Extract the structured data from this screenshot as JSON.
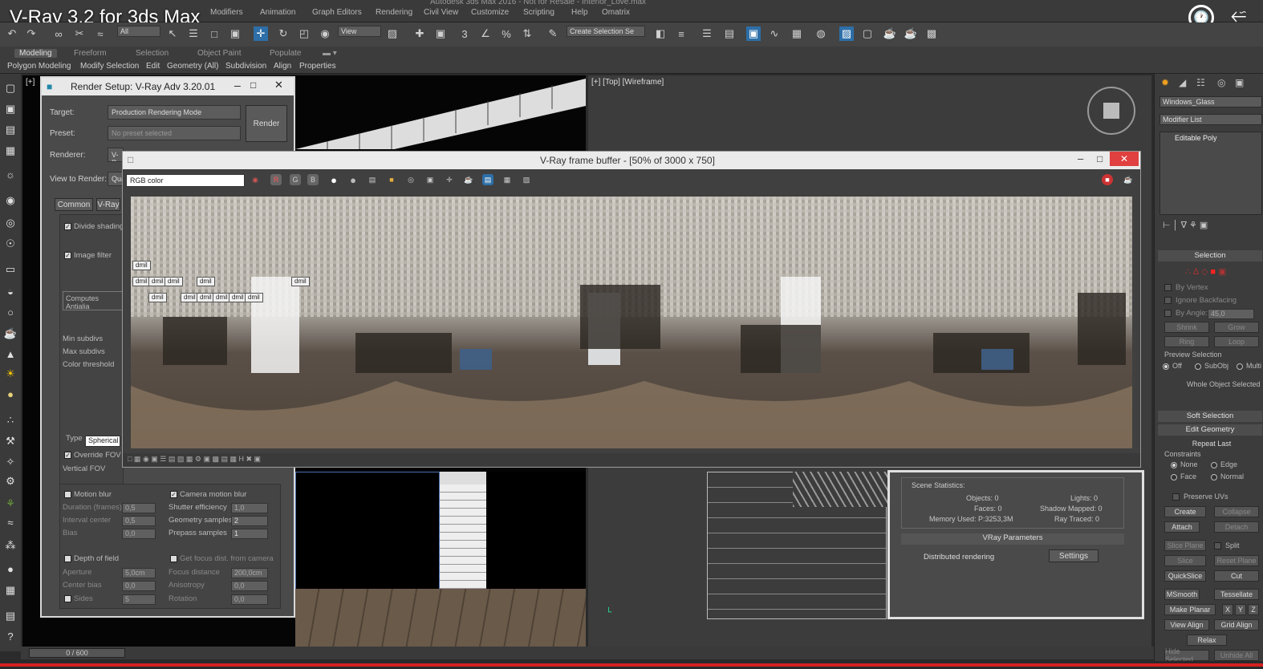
{
  "video": {
    "title": "V-Ray 3.2 for 3ds Max",
    "clock_icon": "clock-icon",
    "share_icon": "share-icon"
  },
  "app": {
    "title": "Autodesk 3ds Max 2016 - Not for Resale - Interior_Love.max"
  },
  "menus": [
    "Modifiers",
    "Animation",
    "Graph Editors",
    "Rendering",
    "Civil View",
    "Customize",
    "Scripting",
    "Help",
    "Omatrix"
  ],
  "toolbar": {
    "selection_filter": "All",
    "ref_coord": "View",
    "selection_set": "Create Selection Se"
  },
  "ribbon": {
    "tabs": [
      "Modeling",
      "Freeform",
      "Selection",
      "Object Paint",
      "Populate"
    ],
    "active_tab": "Modeling",
    "subtabs": [
      "Polygon Modeling",
      "Modify Selection",
      "Edit",
      "Geometry (All)",
      "Subdivision",
      "Align",
      "Properties"
    ]
  },
  "viewport_top": {
    "label": "[+] [Top] [Wireframe]"
  },
  "viewport_left": {
    "label": "[+]"
  },
  "render_setup": {
    "title": "Render Setup: V-Ray Adv 3.20.01",
    "target_label": "Target:",
    "target_value": "Production Rendering Mode",
    "preset_label": "Preset:",
    "preset_value": "No preset selected",
    "renderer_label": "Renderer:",
    "renderer_value": "V-Ray",
    "view_label": "View to Render:",
    "view_value": "Quad",
    "render_button": "Render",
    "tabs": [
      "Common",
      "V-Ray"
    ],
    "divide_shading": "Divide shading",
    "image_filter": "Image filter",
    "computes_aa": "Computes Antialia",
    "min_subdivs": "Min subdivs",
    "max_subdivs": "Max subdivs",
    "color_threshold": "Color threshold",
    "type_label": "Type",
    "type_value": "Spherical p",
    "override_fov": "Override FOV",
    "vertical_fov": "Vertical FOV",
    "motion_blur": "Motion blur",
    "camera_motion_blur": "Camera motion blur",
    "duration_label": "Duration (frames)",
    "duration_value": "0,5",
    "shutter_label": "Shutter efficiency",
    "shutter_value": "1,0",
    "interval_label": "Interval center",
    "interval_value": "0,5",
    "geom_samples_label": "Geometry samples",
    "geom_samples_value": "2",
    "bias_label": "Bias",
    "bias_value": "0,0",
    "prepass_label": "Prepass samples",
    "prepass_value": "1",
    "dof": "Depth of field",
    "focus_from_camera": "Get focus dist. from camera",
    "aperture_label": "Aperture",
    "aperture_value": "5,0cm",
    "focus_dist_label": "Focus distance",
    "focus_dist_value": "200,0cm",
    "center_bias_label": "Center bias",
    "center_bias_value": "0,0",
    "anisotropy_label": "Anisotropy",
    "anisotropy_value": "0,0",
    "sides_label": "Sides",
    "sides_value": "5",
    "rotation_label": "Rotation",
    "rotation_value": "0,0"
  },
  "frame_buffer": {
    "title": "V-Ray frame buffer - [50% of 3000 x 750]",
    "channel": "RGB color",
    "bucket_label": "dmil"
  },
  "stats": {
    "header": "Scene Statistics:",
    "objects": "Objects: 0",
    "lights": "Lights: 0",
    "faces": "Faces: 0",
    "shadow_mapped": "Shadow Mapped: 0",
    "memory": "Memory Used: P:3253,3M",
    "ray_traced": "Ray Traced: 0",
    "vray_params": "VRay Parameters",
    "distributed": "Distributed rendering",
    "settings_button": "Settings"
  },
  "command_panel": {
    "object_name": "Windows_Glass",
    "modifier_list": "Modifier List",
    "stack_item": "Editable Poly",
    "selection": "Selection",
    "by_vertex": "By Vertex",
    "ignore_backfacing": "Ignore Backfacing",
    "by_angle": "By Angle:",
    "by_angle_value": "45,0",
    "shrink": "Shrink",
    "grow": "Grow",
    "ring": "Ring",
    "loop": "Loop",
    "preview_selection": "Preview Selection",
    "preview_off": "Off",
    "preview_subobj": "SubObj",
    "preview_multi": "Multi",
    "whole_object": "Whole Object Selected",
    "soft_selection": "Soft Selection",
    "edit_geometry": "Edit Geometry",
    "repeat_last": "Repeat Last",
    "constraints": "Constraints",
    "none": "None",
    "edge": "Edge",
    "face": "Face",
    "normal": "Normal",
    "preserve_uvs": "Preserve UVs",
    "create": "Create",
    "collapse": "Collapse",
    "attach": "Attach",
    "detach": "Detach",
    "slice_plane": "Slice Plane",
    "split": "Split",
    "slice": "Slice",
    "reset_plane": "Reset Plane",
    "quickslice": "QuickSlice",
    "cut": "Cut",
    "msmooth": "MSmooth",
    "tessellate": "Tessellate",
    "make_planar": "Make Planar",
    "x": "X",
    "y": "Y",
    "z": "Z",
    "view_align": "View Align",
    "grid_align": "Grid Align",
    "relax": "Relax",
    "hide_selected": "Hide Selected",
    "unhide_all": "Unhide All"
  },
  "timeline": {
    "frame": "0 / 600"
  },
  "colors": {
    "accent_blue": "#2d6fa8",
    "close_red": "#e04040",
    "progress_red": "#d42020"
  }
}
